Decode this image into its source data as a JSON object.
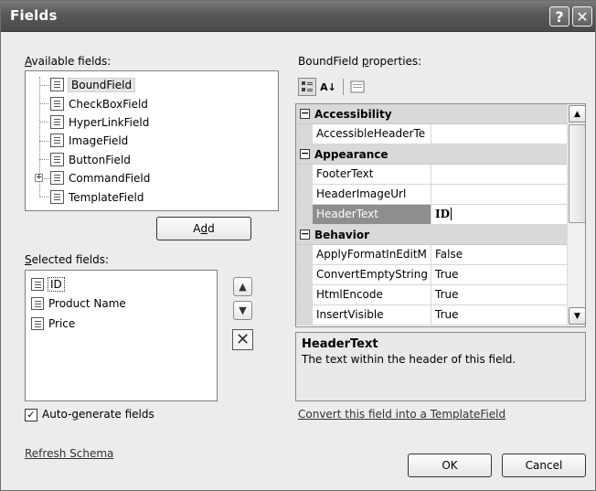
{
  "window": {
    "title": "Fields",
    "help_glyph": "?",
    "close_glyph": "✕"
  },
  "available": {
    "label_access": "A",
    "label_rest": "vailable fields:",
    "items": [
      {
        "label": "BoundField",
        "icon": "bound-field-icon"
      },
      {
        "label": "CheckBoxField",
        "icon": "checkbox-field-icon"
      },
      {
        "label": "HyperLinkField",
        "icon": "hyperlink-field-icon"
      },
      {
        "label": "ImageField",
        "icon": "image-field-icon"
      },
      {
        "label": "ButtonField",
        "icon": "button-field-icon"
      },
      {
        "label": "CommandField",
        "icon": "command-field-icon"
      },
      {
        "label": "TemplateField",
        "icon": "template-field-icon"
      }
    ],
    "expander_glyph": "+",
    "add_pre": "A",
    "add_access": "d",
    "add_post": "d"
  },
  "selected": {
    "label_access": "S",
    "label_rest": "elected fields:",
    "items": [
      {
        "label": "ID"
      },
      {
        "label": "Product Name"
      },
      {
        "label": "Price"
      }
    ],
    "up_glyph": "▲",
    "down_glyph": "▼",
    "delete_glyph": "✕"
  },
  "properties": {
    "label_pre": "BoundField ",
    "label_access": "p",
    "label_post": "roperties:",
    "categorized_icon": "categorized-icon",
    "alpha_glyph": "A↓",
    "pages_icon": "property-pages-icon",
    "collapse_glyph": "−",
    "categories": [
      {
        "name": "Accessibility",
        "rows": [
          {
            "name": "AccessibleHeaderTe",
            "value": ""
          }
        ]
      },
      {
        "name": "Appearance",
        "rows": [
          {
            "name": "FooterText",
            "value": ""
          },
          {
            "name": "HeaderImageUrl",
            "value": ""
          },
          {
            "name": "HeaderText",
            "value": "ID"
          }
        ]
      },
      {
        "name": "Behavior",
        "rows": [
          {
            "name": "ApplyFormatInEditM",
            "value": "False"
          },
          {
            "name": "ConvertEmptyString",
            "value": "True"
          },
          {
            "name": "HtmlEncode",
            "value": "True"
          },
          {
            "name": "InsertVisible",
            "value": "True"
          }
        ]
      }
    ],
    "scroll_up_glyph": "▲",
    "scroll_down_glyph": "▼",
    "description_title": "HeaderText",
    "description_text": "The text within the header of this field."
  },
  "bottom": {
    "autogen_check": "✓",
    "autogen_pre": "Auto-",
    "autogen_access": "g",
    "autogen_post": "enerate fields",
    "convert_link": "Convert this field into a TemplateField",
    "refresh_link": "Refresh Schema",
    "ok_label": "OK",
    "cancel_label": "Cancel"
  }
}
